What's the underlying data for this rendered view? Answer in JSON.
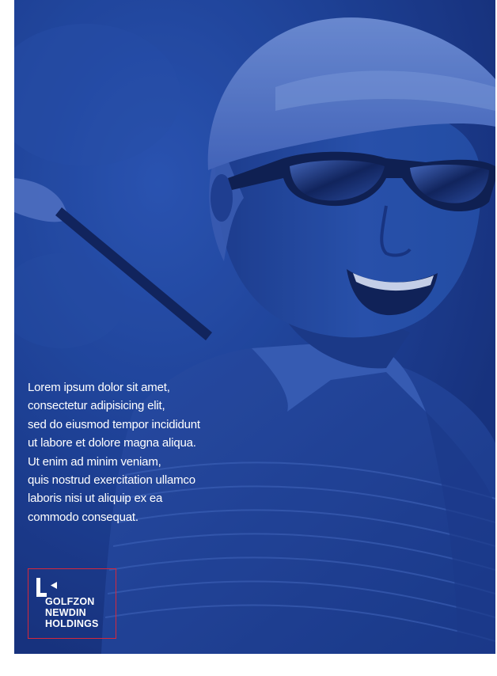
{
  "colors": {
    "duotone_blue": "#1e3d8f",
    "text": "#ffffff",
    "logo_border": "#d6283b"
  },
  "body_text": {
    "lines": [
      "Lorem ipsum dolor sit amet,",
      "consectetur adipisicing elit,",
      "sed do eiusmod tempor incididunt",
      "ut labore et dolore magna aliqua.",
      "Ut enim ad minim veniam,",
      "quis nostrud exercitation ullamco",
      "laboris nisi ut aliquip ex ea",
      "commodo consequat."
    ]
  },
  "logo": {
    "icon": "golfzon-logo-mark",
    "words": [
      "GOLFZON",
      "NEWDIN",
      "HOLDINGS"
    ]
  }
}
